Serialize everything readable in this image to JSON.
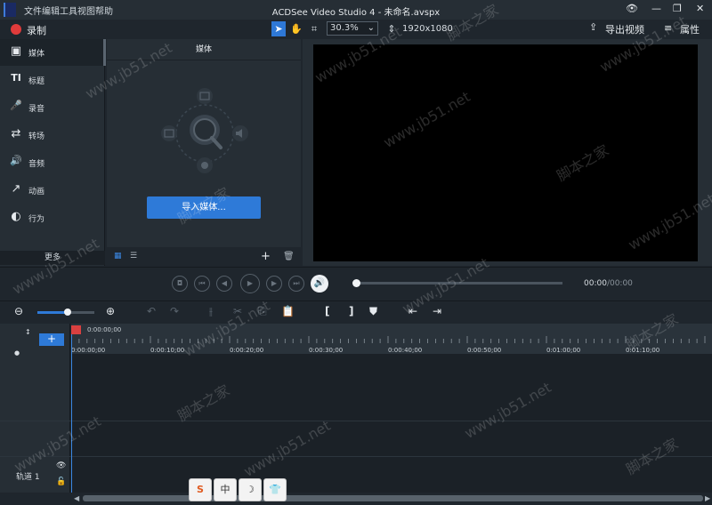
{
  "window": {
    "title": "ACDSee Video Studio 4 - 未命名.avspx",
    "minimize": "—",
    "restore": "❐",
    "close": "✕"
  },
  "menu": [
    "文件",
    "编辑",
    "工具",
    "视图",
    "帮助"
  ],
  "toolbar": {
    "record": "录制",
    "zoom": "30.3%",
    "resolution": "1920x1080",
    "export_video": "导出视频",
    "properties": "属性"
  },
  "sidebar": {
    "items": [
      {
        "label": "媒体",
        "icon": "▣"
      },
      {
        "label": "标题",
        "icon": "TI"
      },
      {
        "label": "录音",
        "icon": "🎤"
      },
      {
        "label": "转场",
        "icon": "⇄"
      },
      {
        "label": "音频",
        "icon": "🔊"
      },
      {
        "label": "动画",
        "icon": "↗"
      },
      {
        "label": "行为",
        "icon": "◐"
      }
    ],
    "more": "更多"
  },
  "media_panel": {
    "title": "媒体",
    "import_button": "导入媒体..."
  },
  "transport": {
    "current_time": "00:00",
    "total_time": "/00:00",
    "progress": 0.0
  },
  "timeline": {
    "cursor_time": "0:00:00;00",
    "ruler_labels": [
      "0:00:00;00",
      "0:00:10;00",
      "0:00:20;00",
      "0:00:30;00",
      "0:00:40;00",
      "0:00:50;00",
      "0:01:00;00",
      "0:01:10;00"
    ],
    "track_name": "轨道 1",
    "add_track": "+",
    "zoom_level": 0.5
  },
  "ime": [
    "S",
    "中",
    "☽",
    "👕"
  ],
  "watermarks": {
    "site": "www.jb51.net",
    "brand": "脚本之家"
  },
  "colors": {
    "accent": "#2e7ad8",
    "record": "#e03b3b",
    "playhead": "#d94040"
  }
}
